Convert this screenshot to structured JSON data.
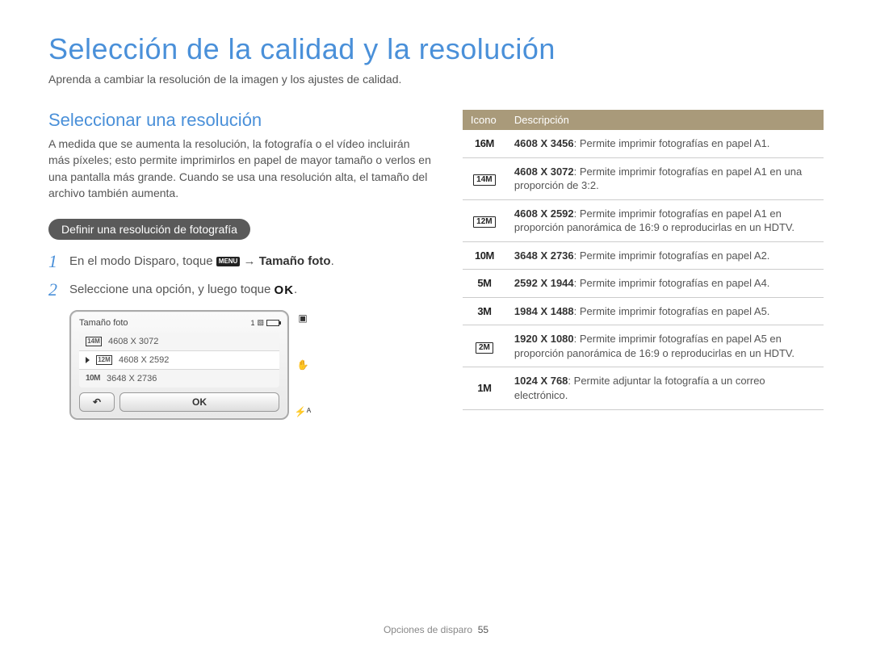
{
  "page_title": "Selección de la calidad y la resolución",
  "intro": "Aprenda a cambiar la resolución de la imagen y los ajustes de calidad.",
  "left": {
    "heading": "Seleccionar una resolución",
    "body": "A medida que se aumenta la resolución, la fotografía o el vídeo incluirán más píxeles; esto permite imprimirlos en papel de mayor tamaño o verlos en una pantalla más grande. Cuando se usa una resolución alta, el tamaño del archivo también aumenta.",
    "pill": "Definir una resolución de fotografía",
    "step1_a": "En el modo Disparo, toque ",
    "step1_menu": "MENU",
    "step1_arrow": " → ",
    "step1_bold": "Tamaño foto",
    "step1_end": ".",
    "step2_a": "Seleccione una opción, y luego toque ",
    "step2_ok": "OK",
    "step2_end": ".",
    "camera": {
      "title": "Tamaño foto",
      "count": "1",
      "rows": [
        {
          "icon": "14M",
          "label": "4608 X 3072"
        },
        {
          "icon": "12M",
          "label": "4608 X 2592"
        },
        {
          "icon": "10M",
          "label": "3648 X 2736"
        }
      ],
      "back": "↶",
      "ok": "OK"
    }
  },
  "table": {
    "head_icon": "Icono",
    "head_desc": "Descripción",
    "rows": [
      {
        "icon_text": "16M",
        "icon_style": "text",
        "dim": "4608 X 3456",
        "desc": ": Permite imprimir fotografías en papel A1."
      },
      {
        "icon_text": "14M",
        "icon_style": "box",
        "dim": "4608 X 3072",
        "desc": ": Permite imprimir fotografías en papel A1 en una proporción de 3:2."
      },
      {
        "icon_text": "12M",
        "icon_style": "box",
        "dim": "4608 X 2592",
        "desc": ": Permite imprimir fotografías en papel A1 en proporción panorámica de 16:9 o reproducirlas en un HDTV."
      },
      {
        "icon_text": "10M",
        "icon_style": "text",
        "dim": "3648 X 2736",
        "desc": ": Permite imprimir fotografías en papel A2."
      },
      {
        "icon_text": "5M",
        "icon_style": "text",
        "dim": "2592 X 1944",
        "desc": ": Permite imprimir fotografías en papel A4."
      },
      {
        "icon_text": "3M",
        "icon_style": "text",
        "dim": "1984 X 1488",
        "desc": ": Permite imprimir fotografías en papel A5."
      },
      {
        "icon_text": "2M",
        "icon_style": "box",
        "dim": "1920 X 1080",
        "desc": ": Permite imprimir fotografías en papel A5 en proporción panorámica de 16:9 o reproducirlas en un HDTV."
      },
      {
        "icon_text": "1M",
        "icon_style": "text",
        "dim": "1024 X 768",
        "desc": ": Permite adjuntar la fotografía a un correo electrónico."
      }
    ]
  },
  "footer": {
    "section": "Opciones de disparo",
    "page": "55"
  }
}
